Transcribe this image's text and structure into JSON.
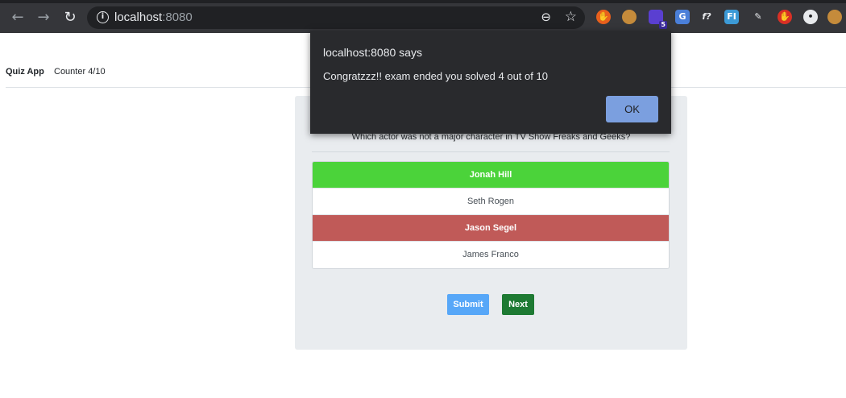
{
  "browser": {
    "url_host": "localhost",
    "url_port": ":8080",
    "extensions": [
      {
        "name": "extension-1",
        "badge": ""
      },
      {
        "name": "extension-2",
        "badge": ""
      },
      {
        "name": "extension-3",
        "badge": "5"
      },
      {
        "name": "extension-4",
        "badge": ""
      },
      {
        "name": "extension-5",
        "text": "f?"
      },
      {
        "name": "extension-6",
        "text": "FI"
      }
    ]
  },
  "navbar": {
    "brand": "Quiz App",
    "counter": "Counter 4/10"
  },
  "quiz": {
    "question": "Which actor was not a major character in TV Show Freaks and Geeks?",
    "answers": [
      {
        "label": "Jonah Hill",
        "state": "correct"
      },
      {
        "label": "Seth Rogen",
        "state": "neutral"
      },
      {
        "label": "Jason Segel",
        "state": "wrong"
      },
      {
        "label": "James Franco",
        "state": "neutral"
      }
    ],
    "submit_label": "Submit",
    "next_label": "Next"
  },
  "dialog": {
    "title": "localhost:8080 says",
    "message": "Congratzzz!! exam ended you solved 4 out of 10",
    "ok_label": "OK"
  },
  "colors": {
    "correct": "#4bd33a",
    "wrong": "#c05a58",
    "submit": "#57a7f8",
    "next": "#1e7a33"
  }
}
